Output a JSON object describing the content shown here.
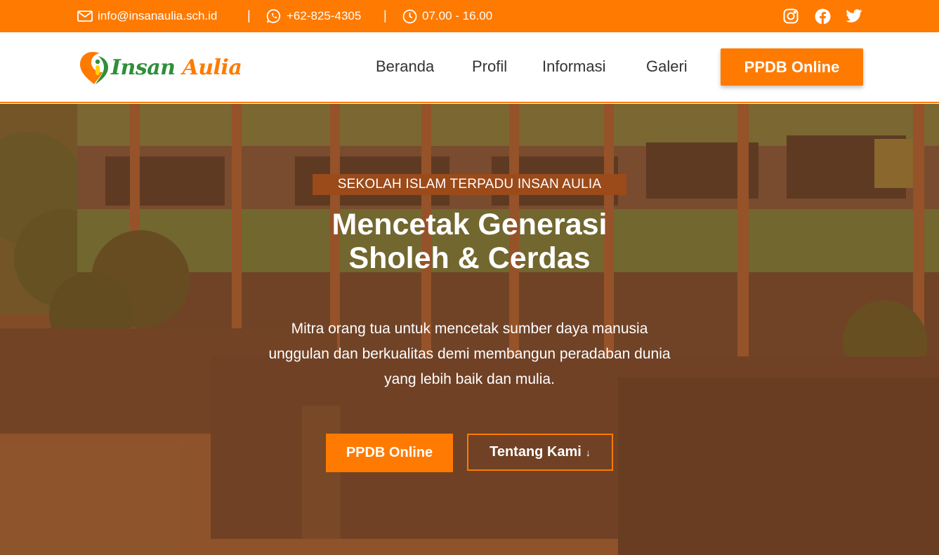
{
  "topbar": {
    "email": "info@insanaulia.sch.id",
    "phone": "+62-825-4305",
    "hours": "07.00 - 16.00",
    "separator": "|",
    "social": [
      "instagram-icon",
      "facebook-icon",
      "twitter-icon"
    ]
  },
  "navbar": {
    "logo_word1": "Insan",
    "logo_word2": "Aulia",
    "links": [
      "Beranda",
      "Profil",
      "Informasi",
      "Galeri"
    ],
    "cta_label": "PPDB Online"
  },
  "hero": {
    "badge": "SEKOLAH ISLAM TERPADU INSAN AULIA",
    "title_line1": "Mencetak Generasi",
    "title_line2": "Sholeh & Cerdas",
    "desc_line1": "Mitra orang tua untuk mencetak sumber daya manusia",
    "desc_line2": "unggulan dan berkualitas demi membangun peradaban dunia",
    "desc_line3": "yang lebih baik dan mulia.",
    "primary_label": "PPDB Online",
    "secondary_label": "Tentang Kami",
    "secondary_arrow": "↓"
  },
  "colors": {
    "brand": "#ff7a00",
    "badge": "#9b4a1a",
    "logo_green": "#2f8f3a"
  }
}
